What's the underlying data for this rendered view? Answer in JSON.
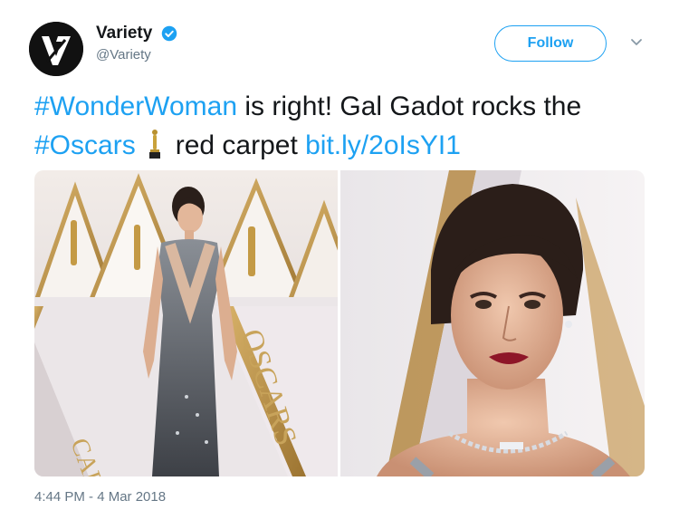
{
  "author": {
    "display_name": "Variety",
    "handle": "@Variety",
    "avatar_letter": "V",
    "verified": true
  },
  "follow_label": "Follow",
  "tweet": {
    "hashtag1": "#WonderWoman",
    "text1": " is right! Gal Gadot rocks the ",
    "hashtag2": "#Oscars",
    "text2": "red carpet ",
    "link": "bit.ly/2oIsYI1"
  },
  "photos": {
    "left_backdrop_text": "OSCARS",
    "left_backdrop_text2": "CARS"
  },
  "timestamp": "4:44 PM - 4 Mar 2018",
  "colors": {
    "brand_blue": "#1da1f2",
    "text": "#14171a",
    "muted": "#657786"
  },
  "icons": [
    "variety-logo-icon",
    "verified-badge-icon",
    "chevron-down-icon",
    "oscar-trophy-icon"
  ]
}
